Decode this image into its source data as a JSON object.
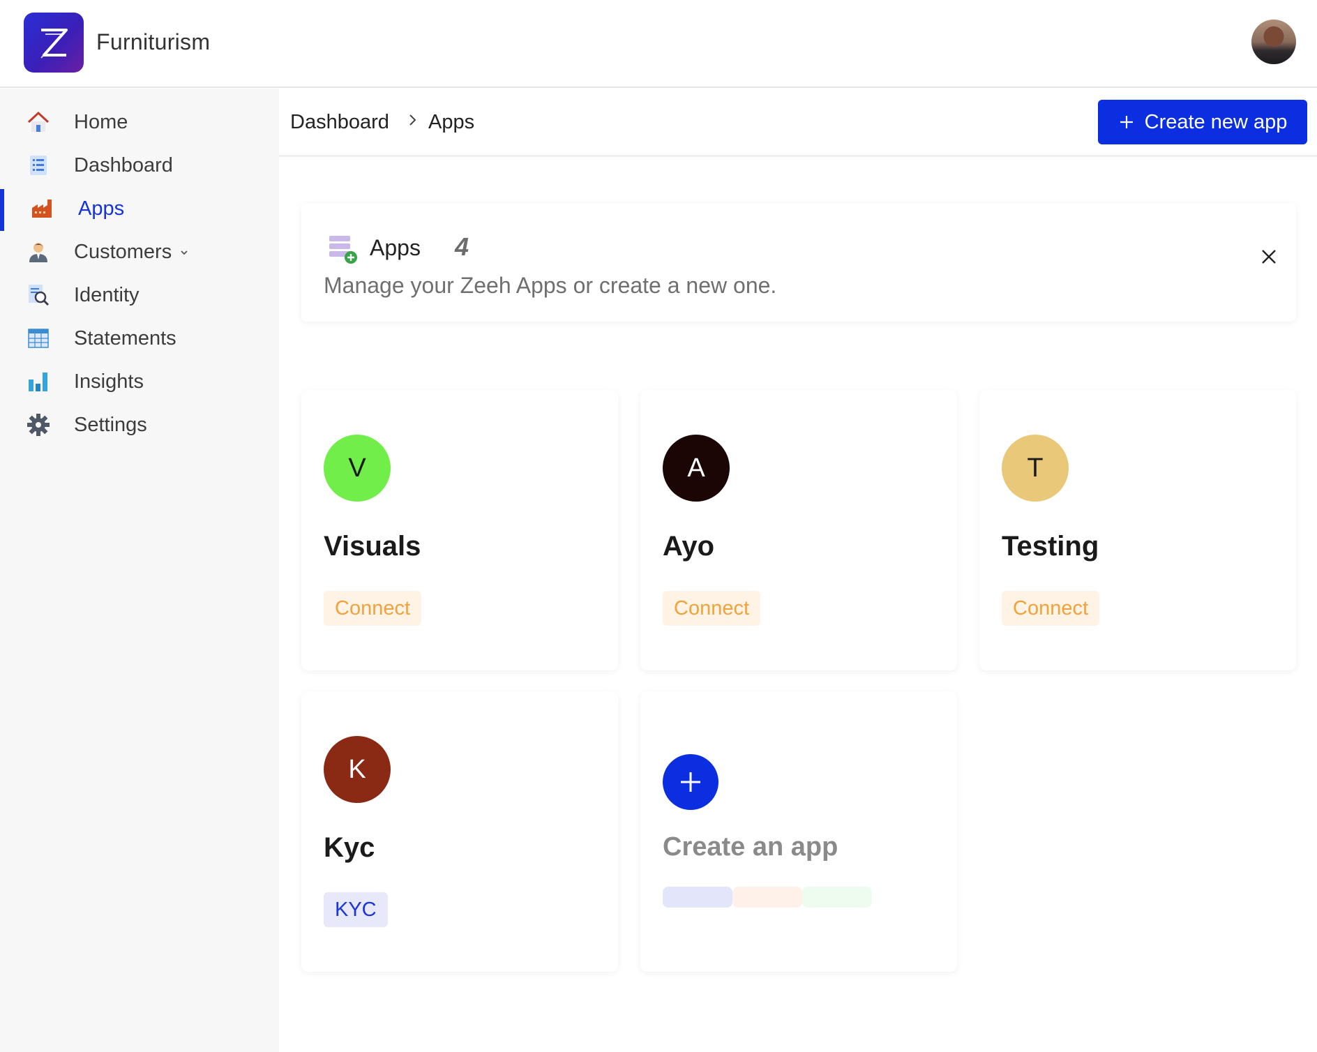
{
  "app": {
    "brand": "Furniturism"
  },
  "sidebar": {
    "items": [
      {
        "label": "Home",
        "icon": "home-icon"
      },
      {
        "label": "Dashboard",
        "icon": "list-icon"
      },
      {
        "label": "Apps",
        "icon": "factory-icon",
        "active": true
      },
      {
        "label": "Customers",
        "icon": "person-icon",
        "has_dropdown": true
      },
      {
        "label": "Identity",
        "icon": "document-search-icon"
      },
      {
        "label": "Statements",
        "icon": "spreadsheet-icon"
      },
      {
        "label": "Insights",
        "icon": "bar-chart-icon"
      },
      {
        "label": "Settings",
        "icon": "gear-icon"
      }
    ]
  },
  "breadcrumb": {
    "parent": "Dashboard",
    "current": "Apps"
  },
  "toolbar": {
    "create_label": "Create new app"
  },
  "banner": {
    "title": "Apps",
    "count": "4",
    "description": "Manage your Zeeh Apps or create a new one."
  },
  "apps": [
    {
      "initial": "V",
      "name": "Visuals",
      "tag": "Connect",
      "color": "#72ee4a",
      "text_color": "#1a1a1a"
    },
    {
      "initial": "A",
      "name": "Ayo",
      "tag": "Connect",
      "color": "#1c0505",
      "text_color": "#ffffff"
    },
    {
      "initial": "T",
      "name": "Testing",
      "tag": "Connect",
      "color": "#eac879",
      "text_color": "#1a1a1a"
    },
    {
      "initial": "K",
      "name": "Kyc",
      "tag": "KYC",
      "color": "#8a2a14",
      "text_color": "#ffffff"
    }
  ],
  "create_card": {
    "label": "Create an app"
  },
  "colors": {
    "accent": "#0a2ee0",
    "connect_bg": "#fff3e6",
    "connect_text": "#f2a23a",
    "kyc_bg": "#e7e9fb",
    "kyc_text": "#1a35d8"
  }
}
